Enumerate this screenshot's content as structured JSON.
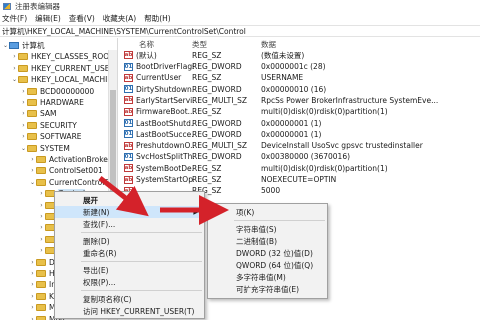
{
  "window": {
    "title": "注册表编辑器"
  },
  "menu": [
    "文件(F)",
    "编辑(E)",
    "查看(V)",
    "收藏夹(A)",
    "帮助(H)"
  ],
  "address": "计算机\\HKEY_LOCAL_MACHINE\\SYSTEM\\CurrentControlSet\\Control",
  "tree": [
    {
      "label": "计算机",
      "level": 0,
      "expanded": true,
      "icon": "computer-icon"
    },
    {
      "label": "HKEY_CLASSES_ROOT",
      "level": 1,
      "expanded": false
    },
    {
      "label": "HKEY_CURRENT_USER",
      "level": 1,
      "expanded": false
    },
    {
      "label": "HKEY_LOCAL_MACHINE",
      "level": 1,
      "expanded": true
    },
    {
      "label": "BCD00000000",
      "level": 2,
      "expanded": false
    },
    {
      "label": "HARDWARE",
      "level": 2,
      "expanded": false
    },
    {
      "label": "SAM",
      "level": 2,
      "expanded": false
    },
    {
      "label": "SECURITY",
      "level": 2,
      "expanded": false
    },
    {
      "label": "SOFTWARE",
      "level": 2,
      "expanded": false
    },
    {
      "label": "SYSTEM",
      "level": 2,
      "expanded": true
    },
    {
      "label": "ActivationBroker",
      "level": 3,
      "expanded": false
    },
    {
      "label": "ControlSet001",
      "level": 3,
      "expanded": false
    },
    {
      "label": "CurrentControlSet",
      "level": 3,
      "expanded": true
    },
    {
      "label": "Control",
      "level": 4,
      "expanded": false,
      "selected": true
    },
    {
      "label": "En",
      "level": 4,
      "expanded": false
    },
    {
      "label": "Ha",
      "level": 4,
      "expanded": false
    },
    {
      "label": "Po",
      "level": 4,
      "expanded": false
    },
    {
      "label": "Se",
      "level": 4,
      "expanded": false
    },
    {
      "label": "Sof",
      "level": 4,
      "expanded": false
    },
    {
      "label": "Driver",
      "level": 3,
      "expanded": false
    },
    {
      "label": "Hard",
      "level": 3,
      "expanded": false
    },
    {
      "label": "Input",
      "level": 3,
      "expanded": false
    },
    {
      "label": "Keyb",
      "level": 3,
      "expanded": false
    },
    {
      "label": "Maps",
      "level": 3,
      "expanded": false
    },
    {
      "label": "Mou",
      "level": 3,
      "expanded": false
    }
  ],
  "columns": {
    "name": "名称",
    "type": "类型",
    "data": "数据"
  },
  "values": [
    {
      "name": "(默认)",
      "type": "REG_SZ",
      "data": "(数值未设置)",
      "kind": "sz"
    },
    {
      "name": "BootDriverFlags",
      "type": "REG_DWORD",
      "data": "0x0000001c (28)",
      "kind": "dw"
    },
    {
      "name": "CurrentUser",
      "type": "REG_SZ",
      "data": "USERNAME",
      "kind": "sz"
    },
    {
      "name": "DirtyShutdown...",
      "type": "REG_DWORD",
      "data": "0x00000010 (16)",
      "kind": "dw"
    },
    {
      "name": "EarlyStartServi...",
      "type": "REG_MULTI_SZ",
      "data": "RpcSs Power BrokerInfrastructure SystemEve...",
      "kind": "sz"
    },
    {
      "name": "FirmwareBoot...",
      "type": "REG_SZ",
      "data": "multi(0)disk(0)rdisk(0)partition(1)",
      "kind": "sz"
    },
    {
      "name": "LastBootShutd...",
      "type": "REG_DWORD",
      "data": "0x00000001 (1)",
      "kind": "dw"
    },
    {
      "name": "LastBootSucce...",
      "type": "REG_DWORD",
      "data": "0x00000001 (1)",
      "kind": "dw"
    },
    {
      "name": "PreshutdownO...",
      "type": "REG_MULTI_SZ",
      "data": "DeviceInstall UsoSvc gpsvc trustedinstaller",
      "kind": "sz"
    },
    {
      "name": "SvcHostSplitTh...",
      "type": "REG_DWORD",
      "data": "0x00380000 (3670016)",
      "kind": "dw"
    },
    {
      "name": "SystemBootDe...",
      "type": "REG_SZ",
      "data": "multi(0)disk(0)rdisk(0)partition(1)",
      "kind": "sz"
    },
    {
      "name": "SystemStartOp...",
      "type": "REG_SZ",
      "data": " NOEXECUTE=OPTIN",
      "kind": "sz"
    },
    {
      "name": "",
      "type": "REG_SZ",
      "data": "5000",
      "kind": "sz"
    }
  ],
  "context_menu": [
    {
      "label": "展开",
      "bold": true
    },
    {
      "label": "新建(N)",
      "hot": true,
      "submenu": true
    },
    {
      "label": "查找(F)..."
    },
    {
      "sep": true
    },
    {
      "label": "删除(D)"
    },
    {
      "label": "重命名(R)"
    },
    {
      "sep": true
    },
    {
      "label": "导出(E)"
    },
    {
      "label": "权限(P)..."
    },
    {
      "sep": true
    },
    {
      "label": "复制项名称(C)"
    },
    {
      "label": "访问 HKEY_CURRENT_USER(T)"
    }
  ],
  "submenu": [
    {
      "label": "项(K)"
    },
    {
      "sep": true
    },
    {
      "label": "字符串值(S)"
    },
    {
      "label": "二进制值(B)"
    },
    {
      "label": "DWORD (32 位)值(D)"
    },
    {
      "label": "QWORD (64 位)值(Q)"
    },
    {
      "label": "多字符串值(M)"
    },
    {
      "label": "可扩充字符串值(E)"
    }
  ],
  "colors": {
    "arrow": "#d4222a",
    "highlight": "#cfe6fb",
    "selection": "#cce4f7"
  }
}
